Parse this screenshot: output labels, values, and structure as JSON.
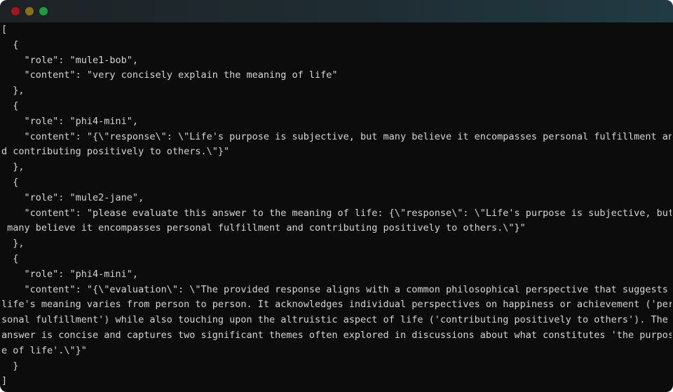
{
  "window": {
    "controls": [
      {
        "name": "close",
        "color": "#a11417"
      },
      {
        "name": "minimize",
        "color": "#867115"
      },
      {
        "name": "maximize",
        "color": "#1d9b3f"
      }
    ]
  },
  "terminal": {
    "lines": [
      "[",
      "  {",
      "    \"role\": \"mule1-bob\",",
      "    \"content\": \"very concisely explain the meaning of life\"",
      "  },",
      "  {",
      "    \"role\": \"phi4-mini\",",
      "    \"content\": \"{\\\"response\\\": \\\"Life's purpose is subjective, but many believe it encompasses personal fulfillment an",
      "d contributing positively to others.\\\"}\"",
      "  },",
      "  {",
      "    \"role\": \"mule2-jane\",",
      "    \"content\": \"please evaluate this answer to the meaning of life: {\\\"response\\\": \\\"Life's purpose is subjective, but",
      " many believe it encompasses personal fulfillment and contributing positively to others.\\\"}\"",
      "  },",
      "  {",
      "    \"role\": \"phi4-mini\",",
      "    \"content\": \"{\\\"evaluation\\\": \\\"The provided response aligns with a common philosophical perspective that suggests",
      "life's meaning varies from person to person. It acknowledges individual perspectives on happiness or achievement ('per",
      "sonal fulfillment') also touching upon the altruistic aspect of life ('contributing positively to others'). The",
      "answer is concise and captures two significant themes often explored in discussions about what constitutes 'the purpos",
      "e of life'.\\\"}\"",
      "  }",
      "]"
    ]
  }
}
